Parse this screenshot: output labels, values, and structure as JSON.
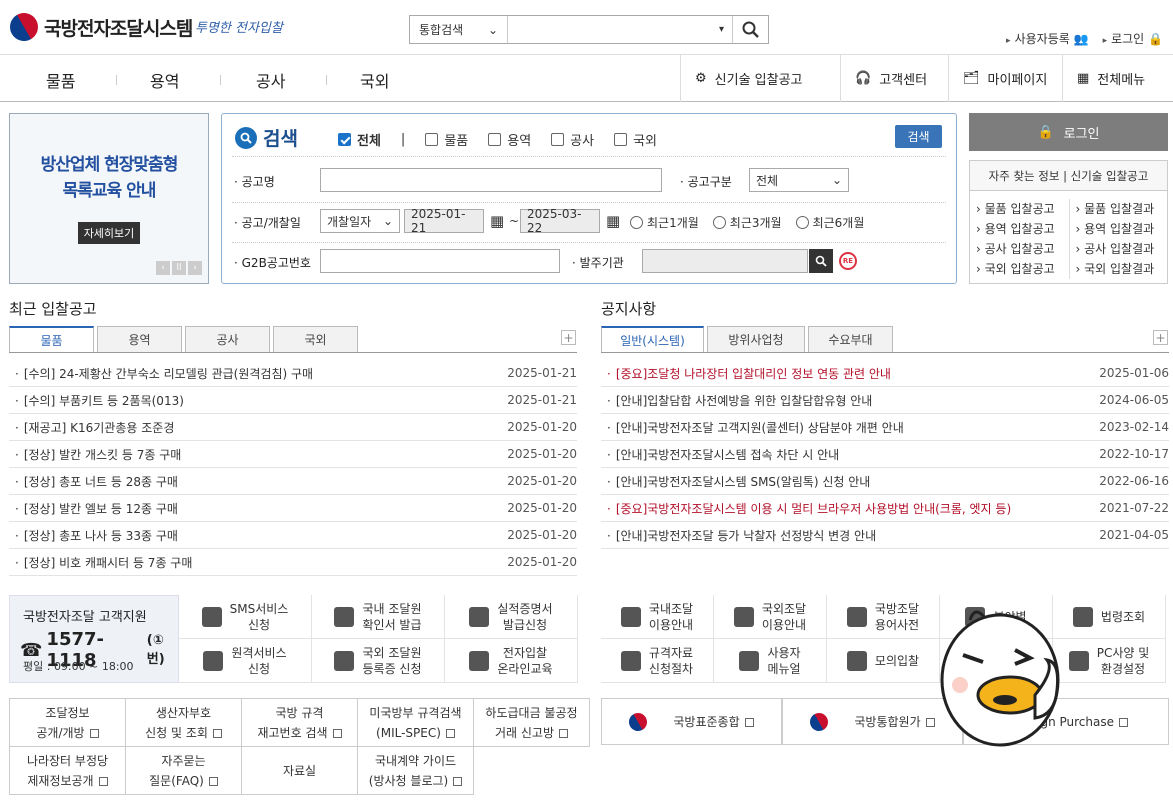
{
  "header": {
    "logo_text": "국방전자조달시스템",
    "slogan": "투명한 전자입찰",
    "search_select": "통합검색",
    "search_input_arrow": "▾",
    "toplinks": [
      "사용자등록",
      "로그인"
    ]
  },
  "nav": {
    "main": [
      "물품",
      "용역",
      "공사",
      "국외"
    ],
    "right": [
      "신기술 입찰공고",
      "고객센터",
      "마이페이지",
      "전체메뉴"
    ]
  },
  "banner": {
    "title_line1": "방산업체 현장맞춤형",
    "title_line2": "목록교육 안내",
    "button": "자세히보기"
  },
  "search": {
    "title": "검색",
    "checks": [
      "전체",
      "물품",
      "용역",
      "공사",
      "국외"
    ],
    "check_sep": "|",
    "button": "검색",
    "label_name": "· 공고명",
    "label_type": "· 공고구분",
    "type_value": "전체",
    "label_date": "· 공고/개찰일",
    "date_type": "개찰일자",
    "date_from": "2025-01-21",
    "date_sep": "~",
    "date_to": "2025-03-22",
    "periods": [
      "최근1개월",
      "최근3개월",
      "최근6개월"
    ],
    "label_g2b": "· G2B공고번호",
    "label_org": "· 발주기관",
    "reset": "RE"
  },
  "login": {
    "button": "로그인",
    "fav_title": "자주 찾는 정보 | 신기술 입찰공고",
    "fav_left": [
      "› 물품 입찰공고",
      "› 용역 입찰공고",
      "› 공사 입찰공고",
      "› 국외 입찰공고"
    ],
    "fav_right": [
      "› 물품 입찰결과",
      "› 용역 입찰결과",
      "› 공사 입찰결과",
      "› 국외 입찰결과"
    ]
  },
  "bids": {
    "title": "최근 입찰공고",
    "tabs": [
      "물품",
      "용역",
      "공사",
      "국외"
    ],
    "plus": "+",
    "items": [
      {
        "t": "[수의] 24-제황산 간부숙소 리모델링 관급(원격검침) 구매",
        "d": "2025-01-21"
      },
      {
        "t": "[수의] 부품키트 등 2품목(013)",
        "d": "2025-01-21"
      },
      {
        "t": "[재공고] K16기관총용 조준경",
        "d": "2025-01-20"
      },
      {
        "t": "[정상] 발칸 개스킷 등 7종 구매",
        "d": "2025-01-20"
      },
      {
        "t": "[정상] 총포 너트 등 28종 구매",
        "d": "2025-01-20"
      },
      {
        "t": "[정상] 발칸 엘보 등 12종 구매",
        "d": "2025-01-20"
      },
      {
        "t": "[정상] 총포 나사 등 33종 구매",
        "d": "2025-01-20"
      },
      {
        "t": "[정상] 비호 캐패시터 등 7종 구매",
        "d": "2025-01-20"
      }
    ]
  },
  "notice": {
    "title": "공지사항",
    "tabs": [
      "일반(시스템)",
      "방위사업청",
      "수요부대"
    ],
    "plus": "+",
    "items": [
      {
        "t": "[중요]조달청 나라장터 입찰대리인 정보 연동 관련 안내",
        "d": "2025-01-06",
        "red": true
      },
      {
        "t": "[안내]입찰담합 사전예방을 위한 입찰담합유형 안내",
        "d": "2024-06-05"
      },
      {
        "t": "[안내]국방전자조달 고객지원(콜센터) 상담분야 개편 안내",
        "d": "2023-02-14"
      },
      {
        "t": "[안내]국방전자조달시스템 접속 차단 시 안내",
        "d": "2022-10-17"
      },
      {
        "t": "[안내]국방전자조달시스템 SMS(알림톡) 신청 안내",
        "d": "2022-06-16"
      },
      {
        "t": "[중요]국방전자조달시스템 이용 시 멀티 브라우저 사용방법 안내(크롬, 엣지 등)",
        "d": "2021-07-22",
        "red": true
      },
      {
        "t": "[안내]국방전자조달 등가 낙찰자 선정방식 변경 안내",
        "d": "2021-04-05"
      }
    ]
  },
  "cs": {
    "title": "국방전자조달 고객지원",
    "phone": "1577-1118",
    "phone_suffix": "(①번)",
    "hours": "평일 : 09:00 ~ 18:00"
  },
  "services": [
    [
      "SMS서비스",
      "신청"
    ],
    [
      "국내 조달원",
      "확인서 발급"
    ],
    [
      "실적증명서",
      "발급신청"
    ],
    [
      "원격서비스",
      "신청"
    ],
    [
      "국외 조달원",
      "등록증 신청"
    ],
    [
      "전자입찰",
      "온라인교육"
    ]
  ],
  "guides": [
    [
      "국내조달",
      "이용안내"
    ],
    [
      "국외조달",
      "이용안내"
    ],
    [
      "국방조달",
      "용어사전"
    ],
    [
      "분야별",
      ""
    ],
    [
      "법령조회",
      ""
    ],
    [
      "규격자료",
      "신청절차"
    ],
    [
      "사용자",
      "메뉴얼"
    ],
    [
      "모의입찰",
      ""
    ],
    [
      "",
      ""
    ],
    [
      "PC사양 및",
      "환경설정"
    ]
  ],
  "links": [
    [
      "조달정보",
      "공개/개방"
    ],
    [
      "생산자부호",
      "신청 및 조회"
    ],
    [
      "국방 규격",
      "재고번호 검색"
    ],
    [
      "미국방부 규격검색",
      "(MIL-SPEC)"
    ],
    [
      "하도급대금 불공정",
      "거래 신고방"
    ],
    [
      "나라장터 부정당",
      "제재정보공개"
    ],
    [
      "자주묻는",
      "질문(FAQ)"
    ],
    [
      "자료실",
      ""
    ],
    [
      "국내계약 가이드",
      "(방사청 블로그)"
    ]
  ],
  "ext_links": [
    "국방표준종합",
    "국방통합원가",
    "eign Purchase"
  ]
}
